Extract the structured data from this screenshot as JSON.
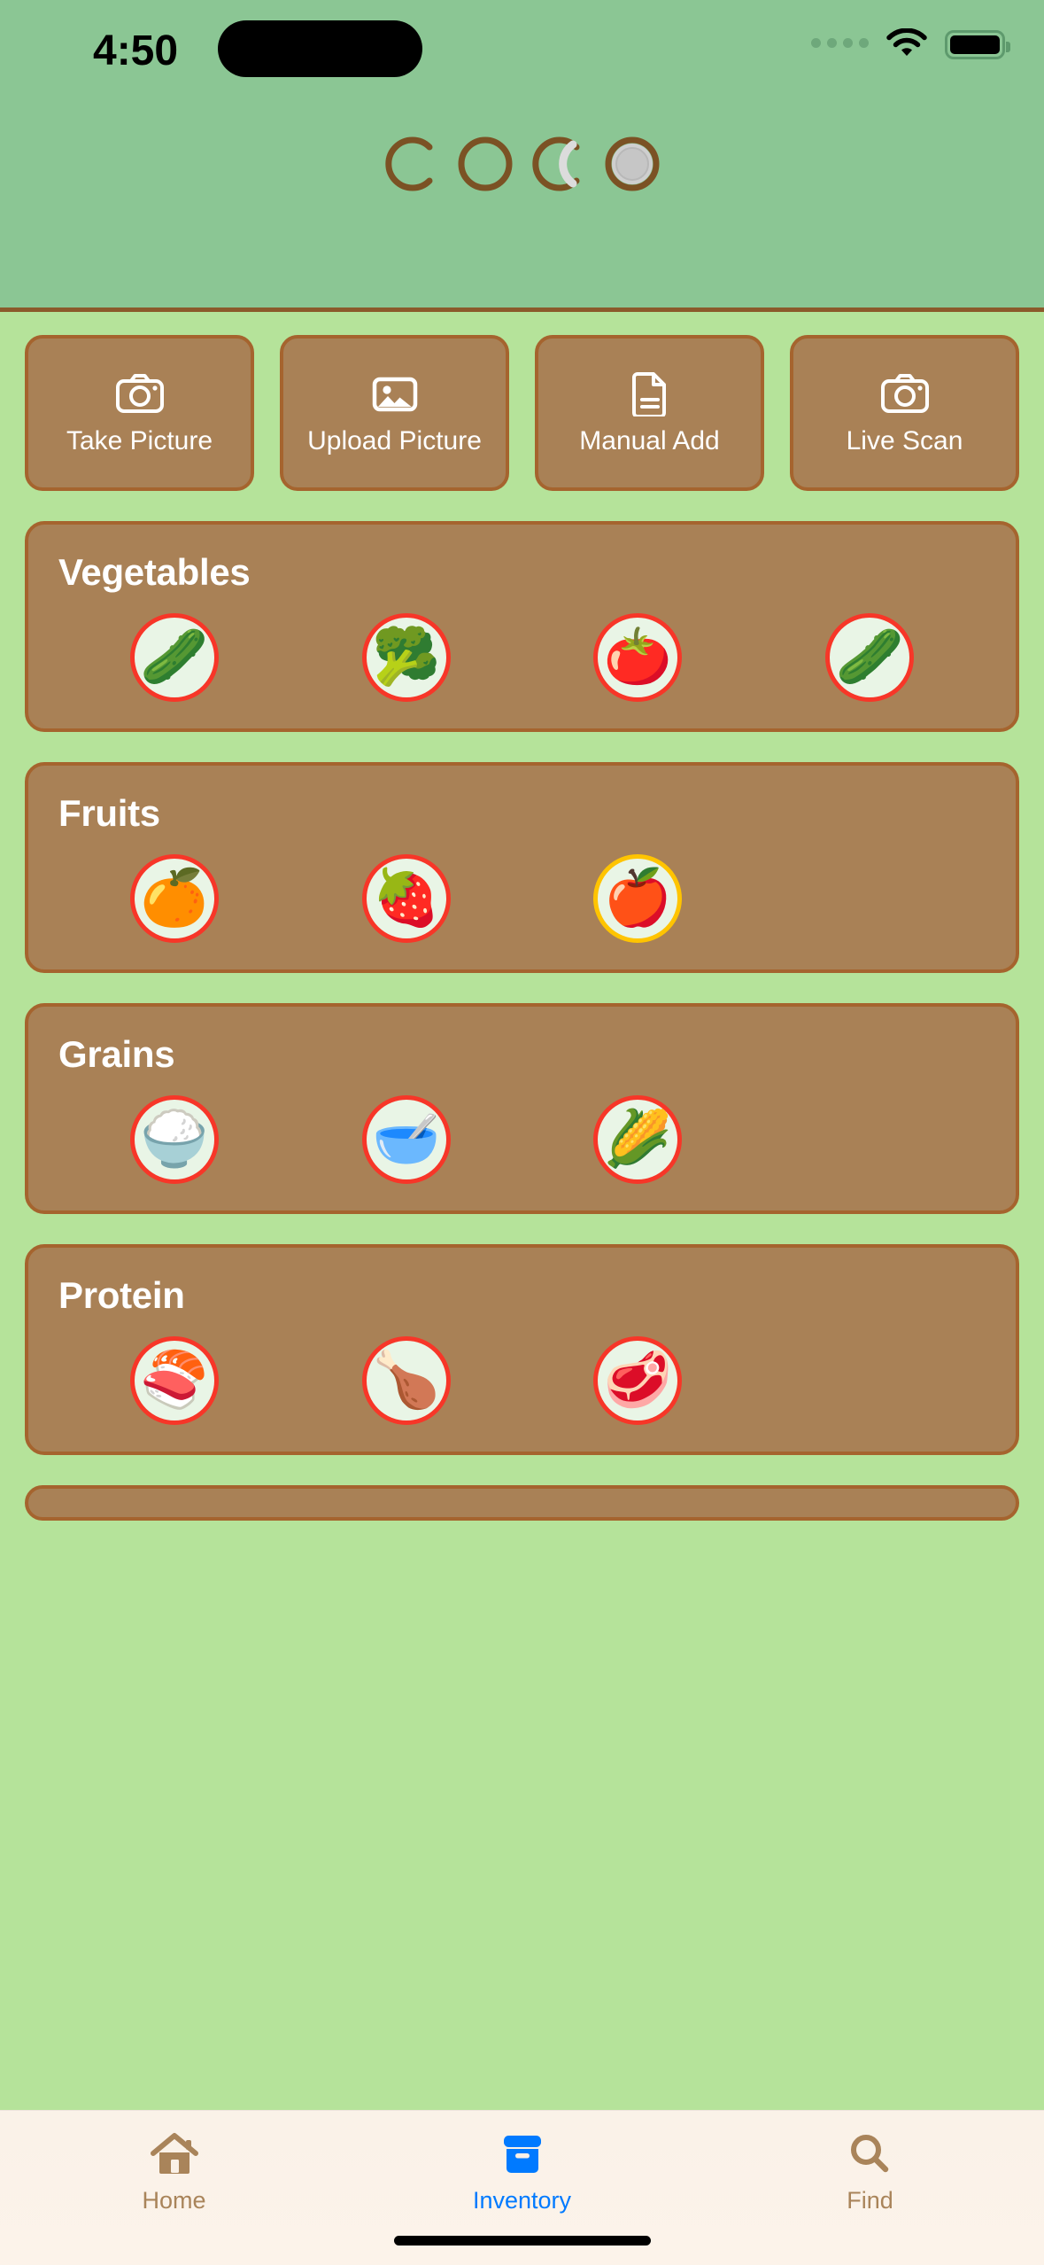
{
  "status_bar": {
    "time": "4:50",
    "signal_icon": "signal-dots-icon",
    "wifi_icon": "wifi-icon",
    "battery_icon": "battery-icon"
  },
  "header": {
    "logo_text": "COCO",
    "logo_letters": [
      "c-open-circle",
      "o-full-circle",
      "c-cracked-coconut",
      "o-coconut-flesh"
    ],
    "background_color": "#8BC694",
    "divider_color": "#8B5A2B"
  },
  "theme": {
    "page_background": "#B5E39A",
    "card_fill": "#A98156",
    "card_border": "#A5642E",
    "expiring_border": "#F73628",
    "soon_border": "#FFC400",
    "active_tab_color": "#007AFF",
    "inactive_tab_color": "#A9845A",
    "tabbar_background": "#FAF0E6"
  },
  "actions": [
    {
      "label": "Take Picture",
      "icon": "camera-icon"
    },
    {
      "label": "Upload Picture",
      "icon": "photo-icon"
    },
    {
      "label": "Manual Add",
      "icon": "document-icon"
    },
    {
      "label": "Live Scan",
      "icon": "camera-icon"
    }
  ],
  "categories": [
    {
      "title": "Vegetables",
      "items": [
        {
          "name": "zucchini",
          "emoji": "🥒",
          "status": "expiring"
        },
        {
          "name": "broccoli",
          "emoji": "🥦",
          "status": "expiring"
        },
        {
          "name": "tomatoes",
          "emoji": "🍅",
          "status": "expiring"
        },
        {
          "name": "cucumber",
          "emoji": "🥒",
          "status": "expiring"
        }
      ]
    },
    {
      "title": "Fruits",
      "items": [
        {
          "name": "oranges",
          "emoji": "🍊",
          "status": "expiring"
        },
        {
          "name": "strawberries",
          "emoji": "🍓",
          "status": "expiring"
        },
        {
          "name": "apples",
          "emoji": "🍎",
          "status": "soon"
        }
      ]
    },
    {
      "title": "Grains",
      "items": [
        {
          "name": "white-rice",
          "emoji": "🍚",
          "status": "expiring"
        },
        {
          "name": "oats",
          "emoji": "🥣",
          "status": "expiring"
        },
        {
          "name": "corn",
          "emoji": "🌽",
          "status": "expiring"
        }
      ]
    },
    {
      "title": "Protein",
      "items": [
        {
          "name": "salmon",
          "emoji": "🍣",
          "status": "expiring"
        },
        {
          "name": "roast-chicken",
          "emoji": "🍗",
          "status": "expiring"
        },
        {
          "name": "steak",
          "emoji": "🥩",
          "status": "expiring"
        }
      ]
    }
  ],
  "tabs": [
    {
      "label": "Home",
      "icon": "home-icon",
      "active": false
    },
    {
      "label": "Inventory",
      "icon": "archive-box-icon",
      "active": true
    },
    {
      "label": "Find",
      "icon": "search-icon",
      "active": false
    }
  ]
}
